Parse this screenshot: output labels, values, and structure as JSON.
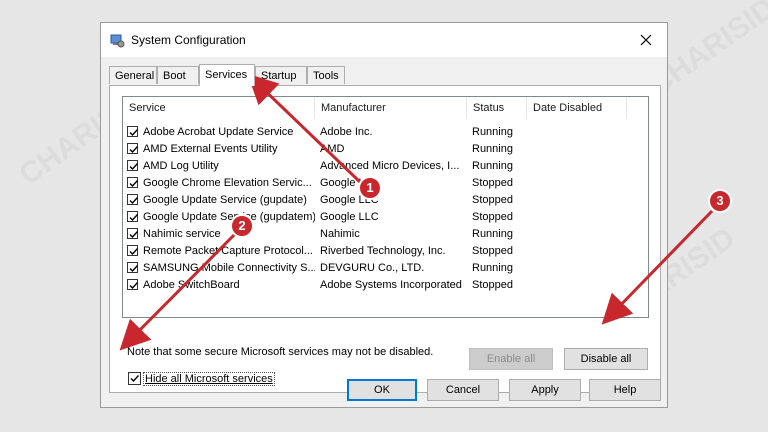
{
  "window": {
    "title": "System Configuration"
  },
  "tabs": [
    "General",
    "Boot",
    "Services",
    "Startup",
    "Tools"
  ],
  "active_tab": "Services",
  "columns": [
    "Service",
    "Manufacturer",
    "Status",
    "Date Disabled"
  ],
  "services": [
    {
      "name": "Adobe Acrobat Update Service",
      "manufacturer": "Adobe Inc.",
      "status": "Running",
      "date_disabled": ""
    },
    {
      "name": "AMD External Events Utility",
      "manufacturer": "AMD",
      "status": "Running",
      "date_disabled": ""
    },
    {
      "name": "AMD Log Utility",
      "manufacturer": "Advanced Micro Devices, I...",
      "status": "Running",
      "date_disabled": ""
    },
    {
      "name": "Google Chrome Elevation Servic...",
      "manufacturer": "Google LLC",
      "status": "Stopped",
      "date_disabled": ""
    },
    {
      "name": "Google Update Service (gupdate)",
      "manufacturer": "Google LLC",
      "status": "Stopped",
      "date_disabled": ""
    },
    {
      "name": "Google Update Service (gupdatem)",
      "manufacturer": "Google LLC",
      "status": "Stopped",
      "date_disabled": ""
    },
    {
      "name": "Nahimic service",
      "manufacturer": "Nahimic",
      "status": "Running",
      "date_disabled": ""
    },
    {
      "name": "Remote Packet Capture Protocol...",
      "manufacturer": "Riverbed Technology, Inc.",
      "status": "Stopped",
      "date_disabled": ""
    },
    {
      "name": "SAMSUNG Mobile Connectivity S...",
      "manufacturer": "DEVGURU Co., LTD.",
      "status": "Running",
      "date_disabled": ""
    },
    {
      "name": "Adobe SwitchBoard",
      "manufacturer": "Adobe Systems Incorporated",
      "status": "Stopped",
      "date_disabled": ""
    }
  ],
  "note": "Note that some secure Microsoft services may not be disabled.",
  "buttons": {
    "enable_all": "Enable all",
    "disable_all": "Disable all",
    "ok": "OK",
    "cancel": "Cancel",
    "apply": "Apply",
    "help": "Help"
  },
  "hide_ms_label": "Hide all Microsoft services",
  "hide_ms_checked": true,
  "markers": [
    "1",
    "2",
    "3"
  ],
  "colors": {
    "accent": "#0078d7",
    "marker": "#c8282d",
    "arrow": "#c8282d"
  },
  "watermark": "CHARISID"
}
